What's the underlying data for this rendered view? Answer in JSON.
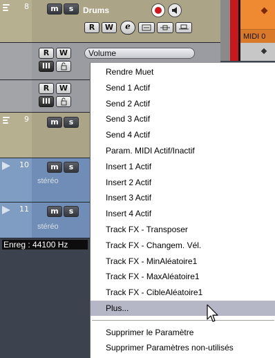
{
  "tracks": [
    {
      "number": "8",
      "name": "Drums",
      "mute_label": "m",
      "solo_label": "s",
      "read_label": "R",
      "write_label": "W"
    },
    {
      "automation_param": "Volume",
      "read_label": "R",
      "write_label": "W"
    },
    {
      "read_label": "R",
      "write_label": "W"
    },
    {
      "number": "9",
      "mute_label": "m",
      "solo_label": "s"
    },
    {
      "number": "10",
      "mute_label": "m",
      "solo_label": "s",
      "subtitle": "stéréo"
    },
    {
      "number": "11",
      "mute_label": "m",
      "solo_label": "s",
      "subtitle": "stéréo"
    }
  ],
  "event": {
    "label": "MIDI 0"
  },
  "status": {
    "text": "Enreg : 44100 Hz"
  },
  "context_menu": {
    "items": [
      {
        "label": "Rendre Muet"
      },
      {
        "label": "Send 1 Actif"
      },
      {
        "label": "Send 2 Actif"
      },
      {
        "label": "Send 3 Actif"
      },
      {
        "label": "Send 4 Actif"
      },
      {
        "label": "Param. MIDI Actif/Inactif"
      },
      {
        "label": "Insert 1 Actif"
      },
      {
        "label": "Insert 2 Actif"
      },
      {
        "label": "Insert 3 Actif"
      },
      {
        "label": "Insert 4 Actif"
      },
      {
        "label": "Track FX - Transposer"
      },
      {
        "label": "Track FX - Changem. Vél."
      },
      {
        "label": "Track FX - MinAléatoire1"
      },
      {
        "label": "Track FX - MaxAléatoire1"
      },
      {
        "label": "Track FX - CibleAléatoire1"
      },
      {
        "label": "Plus...",
        "highlighted": true
      }
    ],
    "footer_items": [
      {
        "label": "Supprimer le Paramètre"
      },
      {
        "label": "Supprimer Paramètres non-utilisés"
      }
    ]
  },
  "colors": {
    "highlight": "#b5b6c6",
    "record_red": "#c7181e",
    "event_orange": "#ef8a33",
    "track_blue": "#7f9cc2",
    "track_olive": "#b7b090"
  }
}
